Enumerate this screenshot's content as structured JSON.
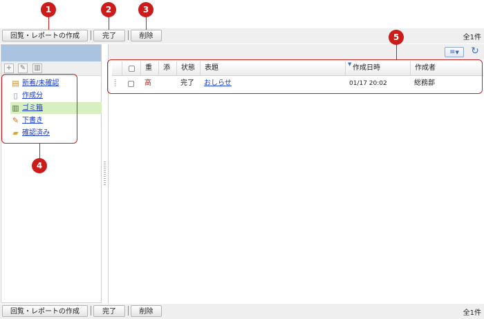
{
  "toolbar": {
    "create_label": "回覧・レポートの作成",
    "done_label": "完了",
    "delete_label": "削除",
    "count": "全1件"
  },
  "callouts": [
    "1",
    "2",
    "3",
    "4",
    "5"
  ],
  "sidebar": {
    "tools": [
      "plus-icon",
      "pencil-icon",
      "trash-icon"
    ],
    "folders": [
      {
        "label": "新着/未確認",
        "icon": "new-mail-icon"
      },
      {
        "label": "作成分",
        "icon": "document-icon"
      },
      {
        "label": "ゴミ箱",
        "icon": "trash-can-icon",
        "selected": true
      },
      {
        "label": "下書き",
        "icon": "pencil-icon"
      },
      {
        "label": "確認済み",
        "icon": "folder-icon"
      }
    ]
  },
  "list": {
    "columns": {
      "importance": "重",
      "attachment": "添",
      "status": "状態",
      "subject": "表題",
      "created": "作成日時",
      "creator": "作成者"
    },
    "sort_column": "created",
    "rows": [
      {
        "importance": "高",
        "attachment": "",
        "status": "完了",
        "subject": "おしらせ",
        "created": "01/17 20:02",
        "creator": "総務部"
      }
    ]
  },
  "colors": {
    "accent": "#cc1b1b",
    "sidebar_header": "#a9c3e0",
    "selected_folder": "#d8f0c0",
    "link": "#1a3acb",
    "importance_high": "#b22222"
  }
}
